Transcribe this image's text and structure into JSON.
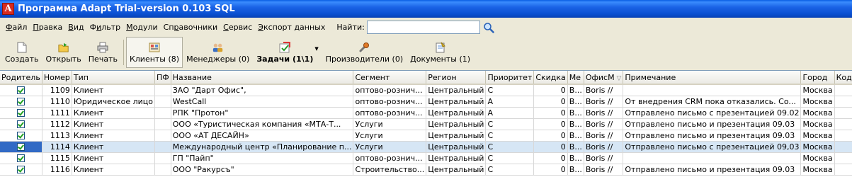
{
  "window": {
    "title": "Программа Adapt Trial-version 0.103 SQL",
    "icon_letter": "A"
  },
  "menu": {
    "items": [
      {
        "pre": "",
        "u": "Ф",
        "post": "айл"
      },
      {
        "pre": "",
        "u": "П",
        "post": "равка"
      },
      {
        "pre": "",
        "u": "В",
        "post": "ид"
      },
      {
        "pre": "Ф",
        "u": "и",
        "post": "льтр"
      },
      {
        "pre": "",
        "u": "М",
        "post": "одули"
      },
      {
        "pre": "Сп",
        "u": "р",
        "post": "авочники"
      },
      {
        "pre": "",
        "u": "С",
        "post": "ервис"
      },
      {
        "pre": "",
        "u": "Э",
        "post": "кспорт данных"
      }
    ],
    "search_label": "Найти:",
    "search_value": ""
  },
  "toolbar": {
    "create": "Создать",
    "open": "Открыть",
    "print": "Печать",
    "clients": "Клиенты (8)",
    "managers": "Менеджеры (0)",
    "tasks": "Задачи (1\\1)",
    "producers": "Производители (0)",
    "documents": "Документы (1)"
  },
  "grid": {
    "columns": [
      "Родитель",
      "Номер",
      "Тип",
      "ПФ",
      "Название",
      "Сегмент",
      "Регион",
      "Приоритет",
      "Скидка",
      "Ме",
      "ОфисМ",
      "Примечание",
      "Город",
      "Код"
    ],
    "rows": [
      {
        "parent": true,
        "num": "1109",
        "type": "Клиент",
        "pf": "",
        "name": "ЗАО \"Дарт Офис\",",
        "segment": "оптово-рознич...",
        "region": "Центральный",
        "priority": "C",
        "discount": "0",
        "me": "В...",
        "office": "Boris //",
        "note": "",
        "city": "Москва",
        "code": ""
      },
      {
        "parent": true,
        "num": "1110",
        "type": "Юридическое лицо",
        "pf": "",
        "name": "WestCall",
        "segment": "оптово-рознич...",
        "region": "Центральный",
        "priority": "A",
        "discount": "0",
        "me": "В...",
        "office": "Boris //",
        "note": "От внедрения CRM пока отказались. Co...",
        "city": "Москва",
        "code": ""
      },
      {
        "parent": true,
        "num": "1111",
        "type": "Клиент",
        "pf": "",
        "name": "РПК \"Протон\"",
        "segment": "оптово-рознич...",
        "region": "Центральный",
        "priority": "A",
        "discount": "0",
        "me": "В...",
        "office": "Boris //",
        "note": "Отправлено письмо с презентацией 09.02",
        "city": "Москва",
        "code": ""
      },
      {
        "parent": true,
        "num": "1112",
        "type": "Клиент",
        "pf": "",
        "name": "ООО «Туристическая компания «МТА-Т...",
        "segment": "Услуги",
        "region": "Центральный",
        "priority": "C",
        "discount": "0",
        "me": "В...",
        "office": "Boris //",
        "note": "Отправлено письмо и презентация 09.03",
        "city": "Москва",
        "code": ""
      },
      {
        "parent": true,
        "num": "1113",
        "type": "Клиент",
        "pf": "",
        "name": "ООО «АТ ДЕСАЙН»",
        "segment": "Услуги",
        "region": "Центральный",
        "priority": "C",
        "discount": "0",
        "me": "В...",
        "office": "Boris //",
        "note": "Отправлено письмо и презентация 09.03",
        "city": "Москва",
        "code": ""
      },
      {
        "parent": true,
        "num": "1114",
        "type": "Клиент",
        "pf": "",
        "name": "Международный центр «Планирование п...",
        "segment": "Услуги",
        "region": "Центральный",
        "priority": "C",
        "discount": "0",
        "me": "В...",
        "office": "Boris //",
        "note": "Отправлено письмо с презентацией 09,03",
        "city": "Москва",
        "code": "",
        "selected": true
      },
      {
        "parent": true,
        "num": "1115",
        "type": "Клиент",
        "pf": "",
        "name": "ГП \"Пайп\"",
        "segment": "оптово-рознич...",
        "region": "Центральный",
        "priority": "C",
        "discount": "0",
        "me": "В...",
        "office": "Boris //",
        "note": "",
        "city": "Москва",
        "code": ""
      },
      {
        "parent": true,
        "num": "1116",
        "type": "Клиент",
        "pf": "",
        "name": "ООО \"Ракурсъ\"",
        "segment": "Строительство...",
        "region": "Центральный",
        "priority": "C",
        "discount": "0",
        "me": "В...",
        "office": "Boris //",
        "note": "Отправлено письмо и презентация 09.03",
        "city": "Москва",
        "code": ""
      }
    ]
  },
  "colors": {
    "titlebar": "#0a4fd0",
    "selection": "#316ac5",
    "check": "#21a121"
  }
}
